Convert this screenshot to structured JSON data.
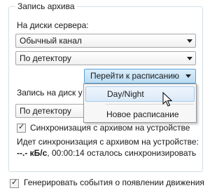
{
  "group": {
    "title": "Запись архива"
  },
  "server": {
    "label": "На диски сервера:",
    "channel": "Обычный канал",
    "mode": "По детектору",
    "schedule_button": "Перейти к расписанию"
  },
  "device": {
    "label": "Запись на диск у",
    "mode": "По детектору",
    "sync_label": "Синхронизация с архивом на устройстве",
    "sync_checked": true,
    "status_line1": "Идет синхронизация с архивом на устройстве:",
    "status_speed": "--.- кБ/с",
    "status_rest": ", 00:00:14 осталось синхронизировать"
  },
  "motion_events": {
    "label": "Генерировать события о появлении движения",
    "checked": true
  },
  "schedule_menu": {
    "items": [
      "Day/Night",
      "Новое расписание"
    ],
    "highlighted": "Day/Night"
  },
  "icons": [
    "chevron-down-icon",
    "checkmark-icon",
    "mouse-cursor-icon"
  ]
}
